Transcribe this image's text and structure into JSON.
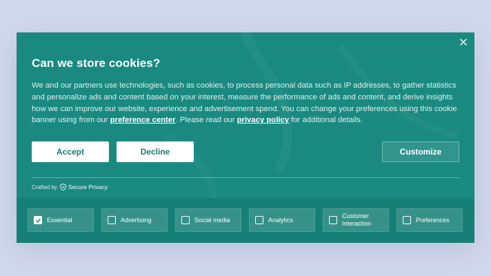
{
  "banner": {
    "title": "Can we store cookies?",
    "desc_part1": "We and our partners use technologies, such as cookies, to process personal data such as IP addresses, to gather statistics and personalize ads and content based on your interest, measure the performance of ads and content, and derive insights how we can improve our website, experience and advertisement spend. You can change your preferences using this cookie banner using from our ",
    "preference_link": "preference center",
    "desc_part2": ". Please read our ",
    "privacy_link": "privacy policy",
    "desc_part3": " for additional details.",
    "buttons": {
      "accept": "Accept",
      "decline": "Decline",
      "customize": "Customize"
    },
    "crafted_by": "Crafted by",
    "brand": "Secure Privacy",
    "close_icon": "close-icon"
  },
  "categories": [
    {
      "label": "Essential",
      "checked": true
    },
    {
      "label": "Advertising",
      "checked": false
    },
    {
      "label": "Social media",
      "checked": false
    },
    {
      "label": "Analytics",
      "checked": false
    },
    {
      "label": "Customer Interaction",
      "checked": false
    },
    {
      "label": "Preferences",
      "checked": false
    }
  ],
  "colors": {
    "page_background": "#d3d9ec",
    "banner": "#1a8a80",
    "button_text": "#157a72"
  }
}
